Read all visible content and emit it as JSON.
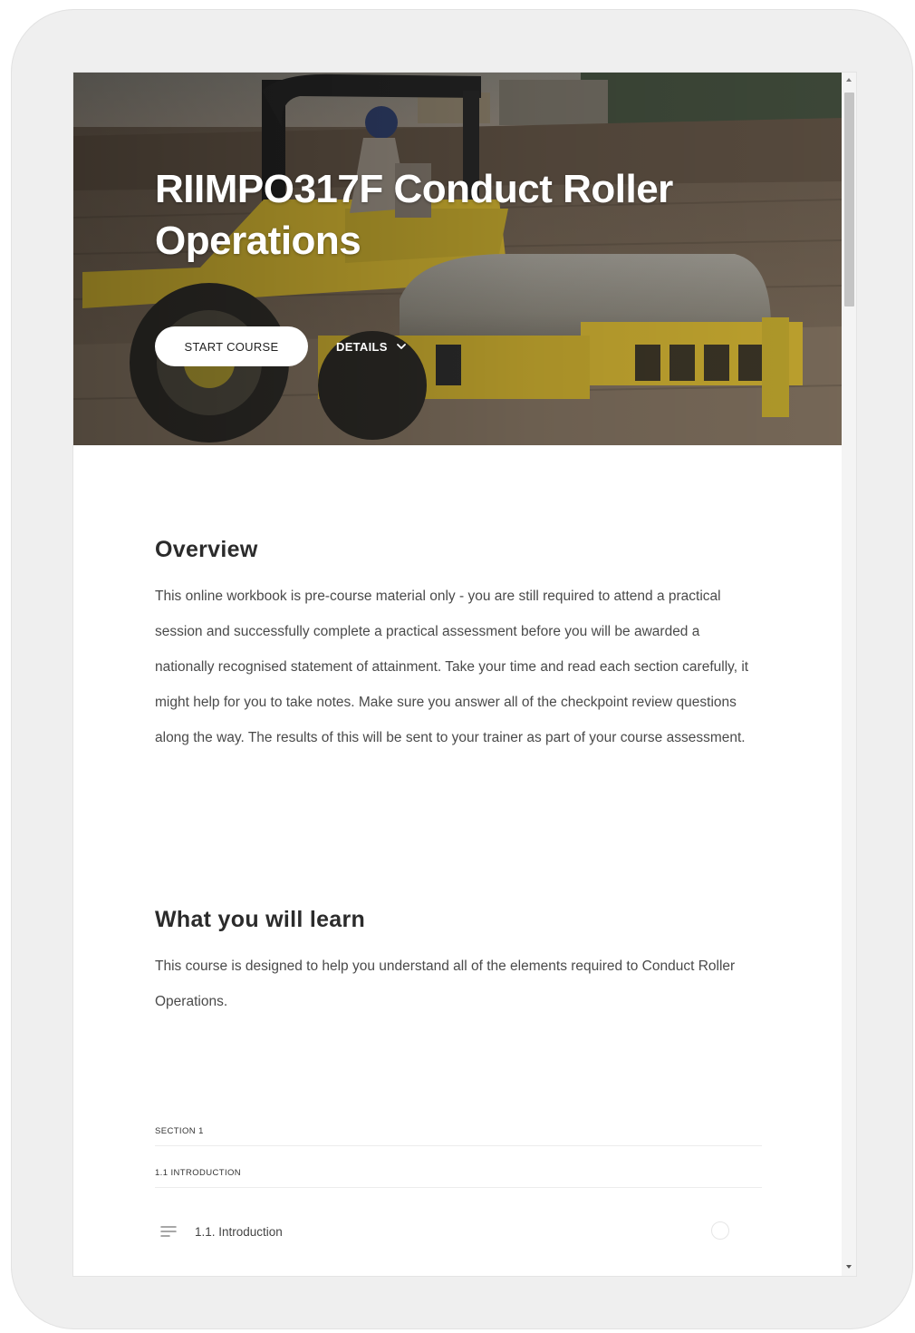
{
  "course": {
    "title": "RIIMPO317F Conduct Roller Operations",
    "start_label": "START COURSE",
    "details_label": "DETAILS"
  },
  "overview": {
    "heading": "Overview",
    "body": "This online workbook is pre-course material only - you are still required to attend a practical session and successfully complete a practical assessment before you will be awarded a nationally recognised statement of attainment. Take your time and read each section carefully, it might help for you to take notes. Make sure you answer all of the checkpoint review questions along the way. The results of this will be sent to your trainer as part of your course assessment."
  },
  "learn": {
    "heading": "What you will learn",
    "body": "This course is designed to help you understand all of the elements required to Conduct Roller Operations."
  },
  "outline": {
    "section_label": "SECTION 1",
    "subsection_label": "1.1 INTRODUCTION",
    "lessons": [
      {
        "title": "1.1. Introduction",
        "icon": "text-lines-icon",
        "status_icon": "empty-circle-icon"
      }
    ]
  },
  "colors": {
    "roller_yellow": "#c9ae2c",
    "device_frame": "#efefef",
    "heading_text": "#2b2b2b",
    "body_text": "#4a4a4a"
  }
}
